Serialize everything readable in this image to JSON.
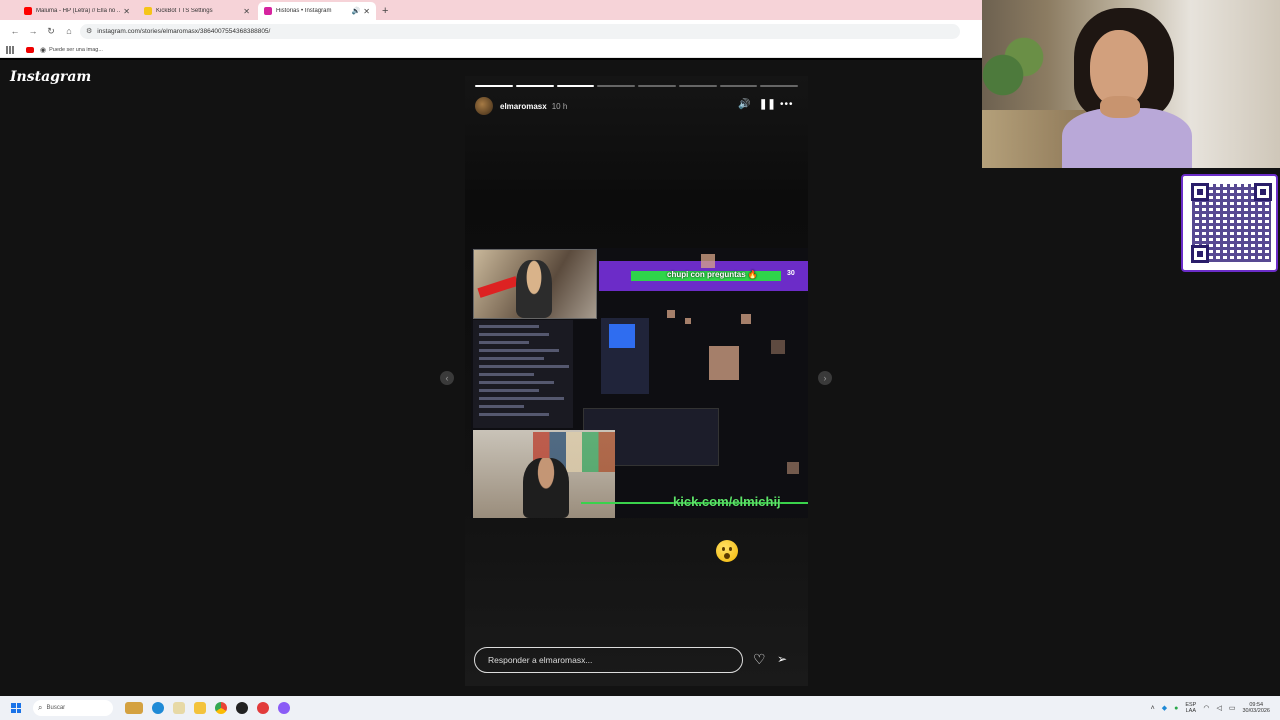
{
  "browser": {
    "tabs": [
      {
        "label": "Maluma - HP (Letra) // Ella no ...",
        "color": "#ff0000",
        "active": false
      },
      {
        "label": "KickBot TTS Settings",
        "color": "#f5c518",
        "active": false
      },
      {
        "label": "Historias • Instagram",
        "color": "#d6249f",
        "active": true
      }
    ],
    "new_tab": "+",
    "url": "instagram.com/stories/elmaromasx/3864007554368388805/",
    "bookmark_label": "Puede ser una imag..."
  },
  "instagram": {
    "logo": "Instagram",
    "story": {
      "username": "elmaromasx",
      "time": "10 h",
      "progress_total": 8,
      "progress_done": 3,
      "overlay_text": "chupi con preguntas 🔥",
      "overlay_count": "30",
      "kick_text": "kick.com/elmichij",
      "reply_placeholder": "Responder a elmaromasx..."
    }
  },
  "taskbar": {
    "search_placeholder": "Buscar",
    "lang_line1": "ESP",
    "lang_line2": "LAA",
    "time": "09:54",
    "date": "30/03/2026"
  }
}
